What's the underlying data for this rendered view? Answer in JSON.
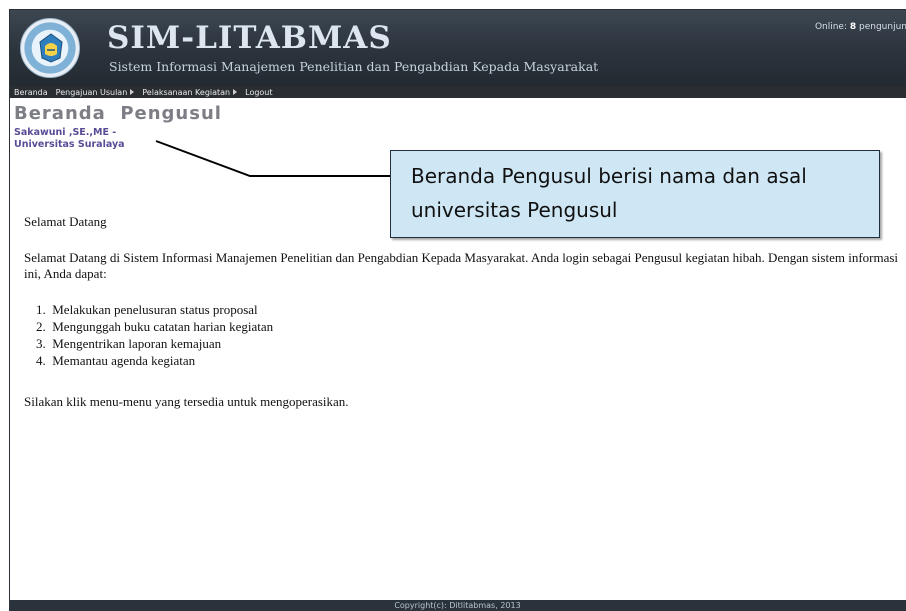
{
  "header": {
    "title": "SIM-LITABMAS",
    "subtitle": "Sistem Informasi Manajemen Penelitian dan Pengabdian Kepada Masyarakat",
    "online_prefix": "Online: ",
    "online_count": "8",
    "online_suffix": " pengunjun"
  },
  "menu": {
    "items": [
      {
        "label": "Beranda",
        "has_arrow": false
      },
      {
        "label": "Pengajuan Usulan",
        "has_arrow": true
      },
      {
        "label": "Pelaksanaan Kegiatan",
        "has_arrow": true
      },
      {
        "label": "Logout",
        "has_arrow": false
      }
    ]
  },
  "page": {
    "title": "Beranda  Pengusul",
    "user_name": "Sakawuni ,SE.,ME -",
    "user_university": "Universitas Suralaya"
  },
  "content": {
    "welcome": "Selamat Datang",
    "intro": "Selamat Datang di Sistem Informasi Manajemen Penelitian dan Pengabdian Kepada Masyarakat. Anda login sebagai Pengusul kegiatan hibah. Dengan sistem informasi ini, Anda dapat:",
    "items": [
      "1.  Melakukan penelusuran status proposal",
      "2.  Mengunggah buku catatan harian kegiatan",
      "3.  Mengentrikan laporan kemajuan",
      "4.  Memantau agenda kegiatan"
    ],
    "closing": "Silakan klik menu-menu yang tersedia untuk mengoperasikan."
  },
  "callout": {
    "text": "Beranda Pengusul berisi nama dan asal universitas Pengusul"
  },
  "footer": {
    "copyright": "Copyright(c): Ditlitabmas, 2013"
  },
  "colors": {
    "header_bg": "#2b333c",
    "menubar_bg": "#2a2e33",
    "page_title": "#7d7d86",
    "user_info": "#5a4b96",
    "callout_bg": "#cfe7f4"
  }
}
